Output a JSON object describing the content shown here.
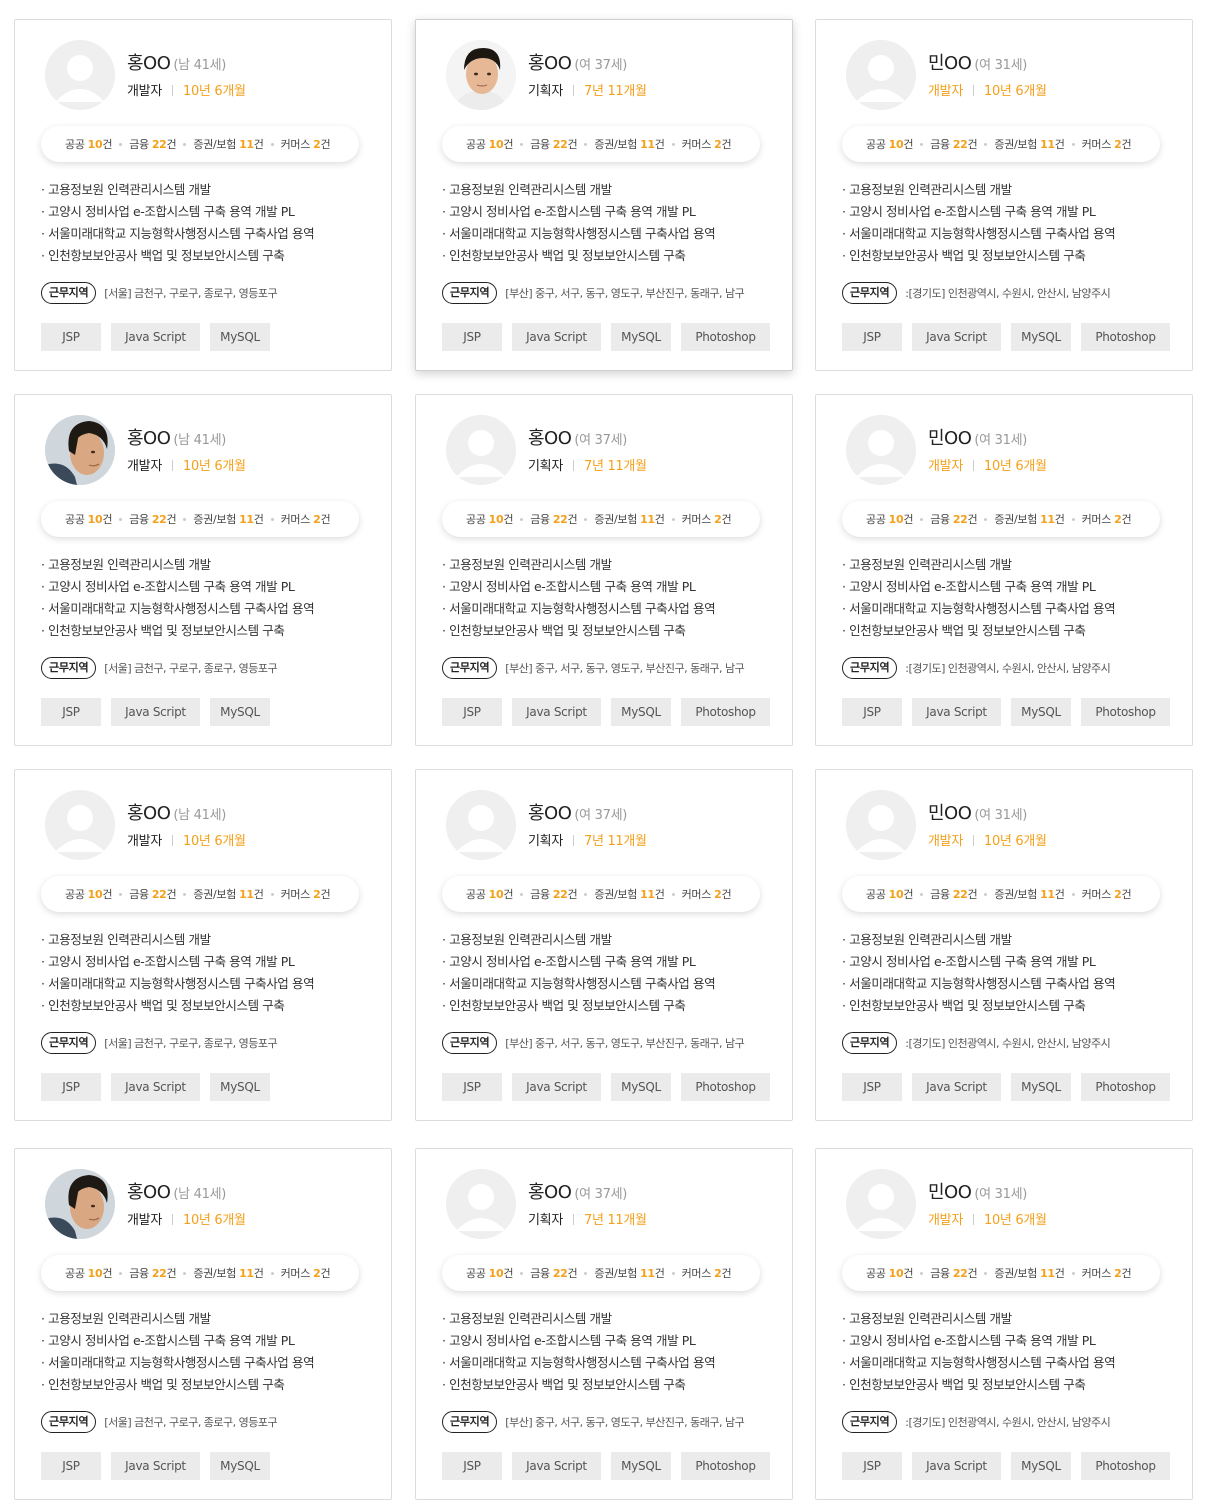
{
  "colors": {
    "accent": "#f5a01a",
    "chip_bg": "#ebebeb",
    "card_border": "#dcdcdc"
  },
  "labels": {
    "region_label": "근무지역"
  },
  "stat_categories": [
    "공공",
    "금융",
    "증권/보험",
    "커머스"
  ],
  "stat_suffix": "건",
  "rows": 4,
  "columns": 3,
  "selected_card_index": 1,
  "column_profiles": [
    {
      "name": "홍OO",
      "meta": "(남 41세)",
      "role": "개발자",
      "role_highlight": false,
      "career": "10년 6개월",
      "stats": [
        10,
        22,
        11,
        2
      ],
      "projects": [
        "· 고용정보원 인력관리시스템 개발",
        "· 고양시 정비사업 e-조합시스템 구축 용역 개발 PL",
        "· 서울미래대학교 지능형학사행정시스템 구축사업 용역",
        "· 인천항보보안공사 백업 및 정보보안시스템 구축"
      ],
      "region": "[서울] 금천구, 구로구, 종로구, 영등포구",
      "skills": [
        "JSP",
        "Java Script",
        "MySQL"
      ]
    },
    {
      "name": "홍OO",
      "meta": "(여 37세)",
      "role": "기획자",
      "role_highlight": false,
      "career": "7년 11개월",
      "stats": [
        10,
        22,
        11,
        2
      ],
      "projects": [
        "· 고용정보원 인력관리시스템 개발",
        "· 고양시 정비사업 e-조합시스템 구축 용역 개발 PL",
        "· 서울미래대학교 지능형학사행정시스템 구축사업 용역",
        "· 인천항보보안공사 백업 및 정보보안시스템 구축"
      ],
      "region": "[부산] 중구, 서구, 동구, 영도구, 부산진구, 동래구, 남구",
      "skills": [
        "JSP",
        "Java Script",
        "MySQL",
        "Photoshop"
      ]
    },
    {
      "name": "민OO",
      "meta": "(여 31세)",
      "role": "개발자",
      "role_highlight": true,
      "career": "10년 6개월",
      "stats": [
        10,
        22,
        11,
        2
      ],
      "projects": [
        "· 고용정보원 인력관리시스템 개발",
        "· 고양시 정비사업 e-조합시스템 구축 용역 개발 PL",
        "· 서울미래대학교 지능형학사행정시스템 구축사업 용역",
        "· 인천항보보안공사 백업 및 정보보안시스템 구축"
      ],
      "region": ":[경기도] 인천광역시, 수원시, 안산시, 남양주시",
      "skills": [
        "JSP",
        "Java Script",
        "MySQL",
        "Photoshop"
      ]
    }
  ],
  "avatars": [
    [
      "placeholder",
      "photo-man-short-hair",
      "placeholder"
    ],
    [
      "photo-man-side-profile",
      "placeholder",
      "placeholder"
    ],
    [
      "placeholder",
      "placeholder",
      "placeholder"
    ],
    [
      "photo-man-side-profile",
      "placeholder",
      "placeholder"
    ]
  ]
}
